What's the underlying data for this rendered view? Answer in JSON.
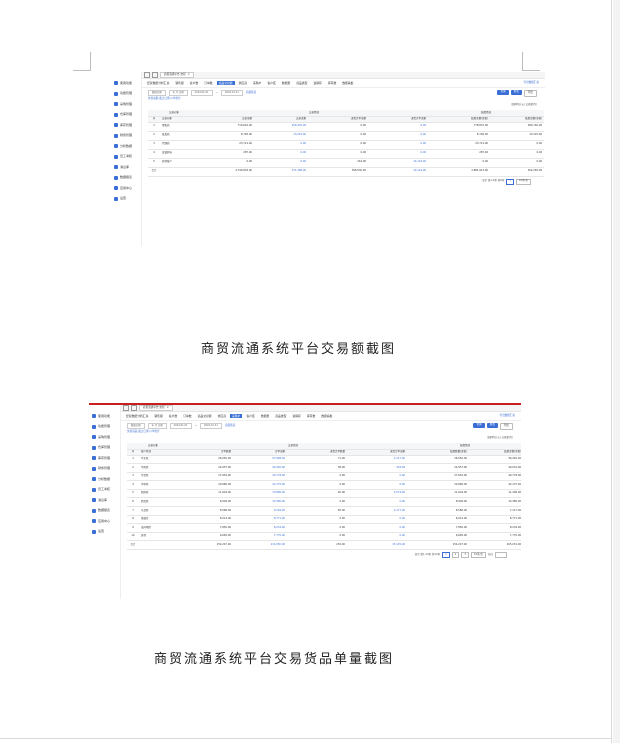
{
  "shot1": {
    "sidebar": [
      {
        "label": "使用功能",
        "color": "#3b6fd6"
      },
      {
        "label": "功能管理",
        "color": "#3b6fd6"
      },
      {
        "label": "采购管理",
        "color": "#3b6fd6"
      },
      {
        "label": "仓库管理",
        "color": "#3b6fd6"
      },
      {
        "label": "库存管理",
        "color": "#3b6fd6"
      },
      {
        "label": "财务管理",
        "color": "#3b6fd6"
      },
      {
        "label": "分析数据",
        "color": "#3b6fd6"
      },
      {
        "label": "员工考核",
        "color": "#3b6fd6"
      },
      {
        "label": "消息库",
        "color": "#3b6fd6"
      },
      {
        "label": "数据报表",
        "color": "#3b6fd6"
      },
      {
        "label": "应用中心",
        "color": "#3b6fd6"
      },
      {
        "label": "设置",
        "color": "#3b6fd6"
      }
    ],
    "top_tab": "商贸流通平台 交易",
    "nav": [
      "经营数据分析汇总",
      "销售额",
      "客户数",
      "订单数",
      "商品交易额",
      "供应商",
      "采购户",
      "客户区",
      "数据量",
      "商品类型",
      "进销存",
      "库存数",
      "数据看板"
    ],
    "nav_active": 4,
    "nav_right": "导出数据汇总",
    "filter": {
      "sel1": "数据日期",
      "sel2": "年 月 日期",
      "date1": "2024-01-01",
      "date2": "2024-01-31",
      "link": "高级筛选"
    },
    "btn_search": "查询",
    "btn_reset": "重置",
    "btn_export": "导出",
    "note": "交易总额 截止日期 以单位计",
    "unit": "金额单位(元) 交易量(件)",
    "group_headers": [
      "交易对象",
      "交易情况",
      "结算情况"
    ],
    "columns": [
      "序",
      "交易对象",
      "交易金额",
      "交易金额",
      "退货订单金额",
      "退货订单金额",
      "结算金额(含税)",
      "结算金额(含税)"
    ],
    "rows": [
      [
        "1",
        "零售商",
        "710,624.00",
        "209,476.00",
        "0.00",
        "0.00",
        "778,837.00",
        "289,740.00"
      ],
      [
        "2",
        "批发商",
        "8,746.00",
        "13,225.00",
        "0.00",
        "0.00",
        "8,746.00",
        "13,225.00"
      ],
      [
        "3",
        "代理商",
        "23,721.00",
        "0.00",
        "0.00",
        "0.00",
        "23,721.00",
        "0.00"
      ],
      [
        "4",
        "连锁超市",
        "287.00",
        "0.00",
        "0.00",
        "0.00",
        "287.00",
        "0.00"
      ],
      [
        "5",
        "其他客户",
        "0.00",
        "0.00",
        "244.00",
        "14,124.00",
        "0.00",
        "0.00"
      ],
      [
        "合计",
        "",
        "2,749,803.00",
        "371,368.00",
        "398,530.00",
        "14,124.00",
        "2,881,913.00",
        "302,265.00"
      ]
    ],
    "pager": "显示 第1-6条 共6条",
    "page": "1",
    "per_page": "10条/页"
  },
  "caption1": "商贸流通系统平台交易额截图",
  "shot2": {
    "sidebar": [
      {
        "label": "使用功能",
        "color": "#3b6fd6"
      },
      {
        "label": "功能管理",
        "color": "#3b6fd6"
      },
      {
        "label": "采购管理",
        "color": "#3b6fd6"
      },
      {
        "label": "仓库管理",
        "color": "#3b6fd6"
      },
      {
        "label": "库存管理",
        "color": "#3b6fd6"
      },
      {
        "label": "财务管理",
        "color": "#3b6fd6"
      },
      {
        "label": "分析数据",
        "color": "#3b6fd6"
      },
      {
        "label": "员工考核",
        "color": "#3b6fd6"
      },
      {
        "label": "消息库",
        "color": "#3b6fd6"
      },
      {
        "label": "数据报表",
        "color": "#3b6fd6"
      },
      {
        "label": "应用中心",
        "color": "#3b6fd6"
      },
      {
        "label": "设置",
        "color": "#3b6fd6"
      }
    ],
    "top_tab": "商贸流通平台 交易",
    "nav": [
      "经营数据分析汇总",
      "销售额",
      "客户数",
      "订单数",
      "商品交易额",
      "供应商",
      "采购户",
      "客户区",
      "数据量",
      "商品类型",
      "进销存",
      "库存数",
      "数据看板"
    ],
    "nav_active": 6,
    "nav_right": "导出数据汇总",
    "filter": {
      "sel1": "数据日期",
      "sel2": "年 月 日期",
      "date1": "2024-01-01",
      "date2": "2024-01-31",
      "link": "高级筛选"
    },
    "btn_search": "查询",
    "btn_reset": "重置",
    "btn_export": "导出",
    "note": "交易货品 截止日期 以单位计",
    "unit": "金额单位(元) 交易量(件)",
    "group_headers": [
      "交易对象",
      "交易情况",
      "结算情况"
    ],
    "columns": [
      "序",
      "客户区域",
      "订单数量",
      "订单金额",
      "退货订单数量",
      "退货订单金额",
      "结算数量(含税)",
      "结算金额(含税)"
    ],
    "rows": [
      [
        "1",
        "华东区",
        "26,050.00",
        "57,898.00",
        "71.00",
        "2,117.00",
        "26,050.00",
        "56,445.00"
      ],
      [
        "2",
        "华南区",
        "24,957.00",
        "40,450.00",
        "38.00",
        "418.00",
        "24,957.00",
        "40,031.00"
      ],
      [
        "3",
        "华北区",
        "27,652.00",
        "29,778.00",
        "0.00",
        "0.00",
        "27,652.00",
        "29,778.00"
      ],
      [
        "4",
        "华中区",
        "20,680.00",
        "22,175.00",
        "0.00",
        "0.00",
        "20,680.00",
        "22,175.00"
      ],
      [
        "5",
        "西南区",
        "11,604.00",
        "13,880.00",
        "40.00",
        "2,574.00",
        "11,604.00",
        "11,306.00"
      ],
      [
        "6",
        "西北区",
        "8,909.00",
        "13,380.00",
        "0.00",
        "0.00",
        "8,909.00",
        "13,380.00"
      ],
      [
        "7",
        "东北区",
        "8,566.00",
        "9,294.00",
        "83.00",
        "2,177.00",
        "8,566.00",
        "7,117.00"
      ],
      [
        "8",
        "港澳台",
        "8,014.00",
        "8,771.00",
        "0.00",
        "0.00",
        "8,014.00",
        "8,771.00"
      ],
      [
        "9",
        "海外地区",
        "7,850.00",
        "8,234.00",
        "0.00",
        "0.00",
        "7,850.00",
        "8,234.00"
      ],
      [
        "10",
        "其他",
        "6,665.00",
        "7,770.00",
        "0.00",
        "0.00",
        "6,665.00",
        "7,770.00"
      ],
      [
        "合计",
        "",
        "154,247.00",
        "211,830.00",
        "232.00",
        "15,125.00",
        "154,247.00",
        "205,031.00"
      ]
    ],
    "pager": "显示 第1-10条 共12条",
    "pages": [
      "1",
      "2",
      "3"
    ],
    "per_page": "10条/页",
    "goto": "前往"
  },
  "caption2": "商贸流通系统平台交易货品单量截图"
}
